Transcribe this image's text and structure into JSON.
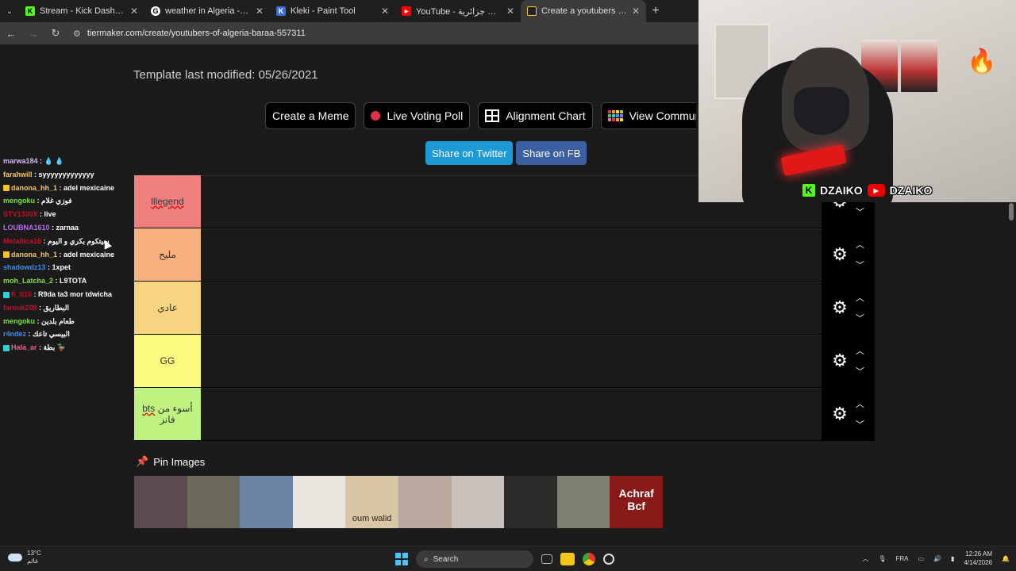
{
  "browser": {
    "tabs": [
      {
        "title": "Stream - Kick Dashboard",
        "icon": "kick-icon",
        "color": "#53fc18"
      },
      {
        "title": "weather in Algeria - Recherche",
        "icon": "google-icon",
        "color": "#ffffff"
      },
      {
        "title": "Kleki - Paint Tool",
        "icon": "kleki-icon",
        "color": "#3b6fd8"
      },
      {
        "title": "YouTube - تقييم اكلات جزائرية",
        "icon": "youtube-icon",
        "color": "#ff0000"
      },
      {
        "title": "Create a youtubers of algeria ti",
        "icon": "tiermaker-icon",
        "color": "#222222"
      }
    ],
    "url": "tiermaker.com/create/youtubers-of-algeria-baraa-557311"
  },
  "page": {
    "modified": "Template last modified: 05/26/2021",
    "buttons": {
      "meme": "Create a Meme",
      "poll": "Live Voting Poll",
      "alignment": "Alignment Chart",
      "community": "View Commun"
    },
    "share": {
      "twitter": "Share on Twitter",
      "fb": "Share on FB"
    },
    "tiers": [
      {
        "label": "lllegend",
        "color": "#f08080"
      },
      {
        "label": "مليح",
        "color": "#f9b27f"
      },
      {
        "label": "عادي",
        "color": "#f7d47f"
      },
      {
        "label": "GG",
        "color": "#fbfb80"
      },
      {
        "label_prefix": "bts",
        "label_suffix": " أسوء من فانز",
        "color": "#bff27f"
      }
    ],
    "pin_title": "Pin Images",
    "pics": [
      {
        "color": "#5c4a52"
      },
      {
        "color": "#6b6a5a"
      },
      {
        "color": "#6d83a6"
      },
      {
        "color": "#e9e6e0"
      },
      {
        "color": "#d9c6a4",
        "caption": "oum walid"
      },
      {
        "color": "#b8a89e"
      },
      {
        "color": "#c9c2bc"
      },
      {
        "color": "#2d2a2a"
      },
      {
        "color": "#7f7f72"
      },
      {
        "color": "#8a1a1a",
        "big": "Achraf Bcf"
      }
    ]
  },
  "chat": [
    {
      "user": "marwa184",
      "color": "#d7b6ff",
      "text": "💧 💧"
    },
    {
      "user": "farahwill",
      "color": "#f5c56b",
      "text": "syyyyyyyyyyyyy"
    },
    {
      "user": "danona_hh_1",
      "color": "#f5c56b",
      "text": "adel mexicaine",
      "badge": "#f5c518"
    },
    {
      "user": "mengoku",
      "color": "#7de33a",
      "text": "فوزي غلام"
    },
    {
      "user": "STV1330X",
      "color": "#c0102a",
      "text": "live"
    },
    {
      "user": "LOUBNA1610",
      "color": "#b66bf0",
      "text": "zarnaa"
    },
    {
      "user": "Metallica16",
      "color": "#c0102a",
      "text": "سيتكوم بكري و اليوم"
    },
    {
      "user": "danona_hh_1",
      "color": "#f5c56b",
      "text": "adel mexicaine",
      "badge": "#f5c518"
    },
    {
      "user": "shadowdz13",
      "color": "#3b8ee8",
      "text": "1xpet"
    },
    {
      "user": "moh_Latcha_2",
      "color": "#7de33a",
      "text": "L9TOTA"
    },
    {
      "user": "fl_ti16",
      "color": "#c0102a",
      "text": "R9da ta3 mor tdwicha",
      "badge": "#34d0d8"
    },
    {
      "user": "farouk209",
      "color": "#c0102a",
      "text": "البطاريق"
    },
    {
      "user": "mengoku",
      "color": "#7de33a",
      "text": "طعام بلدين"
    },
    {
      "user": "r4ndez",
      "color": "#3b8ee8",
      "text": "البيسي تاعك"
    },
    {
      "user": "Hala_ar",
      "color": "#f06090",
      "text": "بطة 🦆",
      "badge": "#34d0d8"
    }
  ],
  "stream": {
    "kick_name": "DZAIKO",
    "yt_name": "DZAIKO"
  },
  "taskbar": {
    "weather_temp": "13°C",
    "weather_place": "غائم",
    "search": "Search",
    "lang": "FRA",
    "time": "12:26 AM",
    "date": "4/14/2026"
  }
}
